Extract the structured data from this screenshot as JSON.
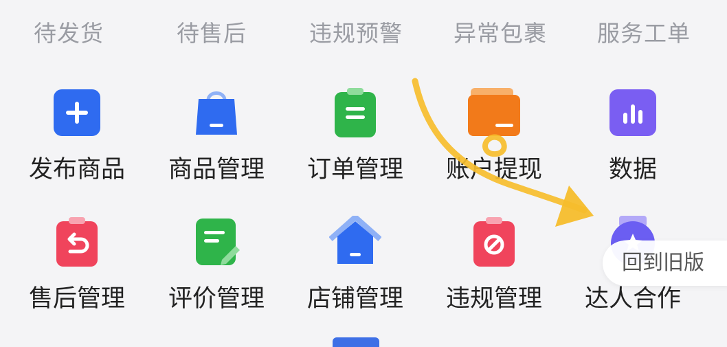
{
  "tabs": [
    "待发货",
    "待售后",
    "违规预警",
    "异常包裹",
    "服务工单"
  ],
  "grid": [
    {
      "label": "发布商品",
      "icon": "plus-icon",
      "color": "#2f6bf0"
    },
    {
      "label": "商品管理",
      "icon": "shopping-bag-icon",
      "color": "#2f6bf0"
    },
    {
      "label": "订单管理",
      "icon": "clipboard-icon",
      "color": "#2fb44a"
    },
    {
      "label": "账户提现",
      "icon": "wallet-icon",
      "color": "#f27a1a"
    },
    {
      "label": "数据",
      "icon": "bar-chart-icon",
      "color": "#7a5ef2"
    },
    {
      "label": "售后管理",
      "icon": "return-icon",
      "color": "#f0445c"
    },
    {
      "label": "评价管理",
      "icon": "note-edit-icon",
      "color": "#2fb44a"
    },
    {
      "label": "店铺管理",
      "icon": "store-icon",
      "color": "#2f6bf0"
    },
    {
      "label": "违规管理",
      "icon": "forbidden-icon",
      "color": "#f0445c"
    },
    {
      "label": "达人合作",
      "icon": "star-medal-icon",
      "color": "#6b5ef2"
    }
  ],
  "floating_button": {
    "label": "回到旧版"
  },
  "annotation_color": "#f6bd2c"
}
